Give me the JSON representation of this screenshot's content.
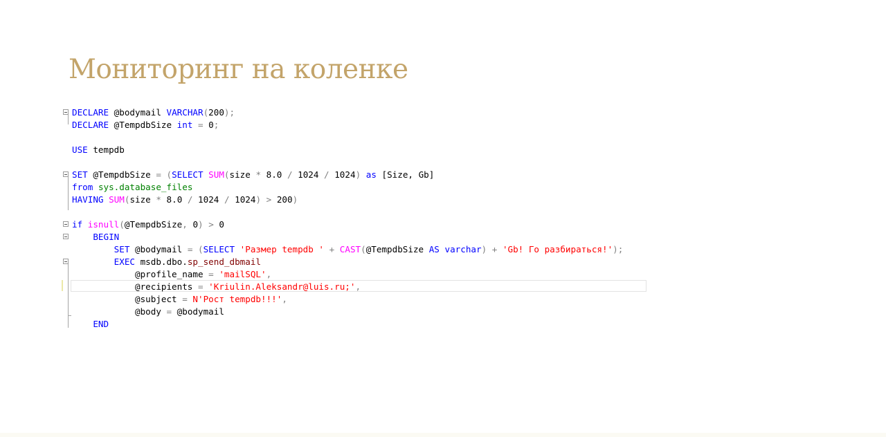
{
  "slide": {
    "title": "Мониторинг на коленке"
  },
  "code_lines": [
    {
      "segments": [
        {
          "t": "DECLARE",
          "c": "kw"
        },
        {
          "t": " @bodymail "
        },
        {
          "t": "VARCHAR",
          "c": "kw"
        },
        {
          "t": "(",
          "c": "op"
        },
        {
          "t": "200"
        },
        {
          "t": ");",
          "c": "op"
        }
      ]
    },
    {
      "segments": [
        {
          "t": "DECLARE",
          "c": "kw"
        },
        {
          "t": " @TempdbSize "
        },
        {
          "t": "int",
          "c": "kw"
        },
        {
          "t": " = ",
          "c": "op"
        },
        {
          "t": "0"
        },
        {
          "t": ";",
          "c": "op"
        }
      ]
    },
    {
      "segments": []
    },
    {
      "segments": [
        {
          "t": "USE",
          "c": "kw"
        },
        {
          "t": " tempdb"
        }
      ]
    },
    {
      "segments": []
    },
    {
      "segments": [
        {
          "t": "SET",
          "c": "kw"
        },
        {
          "t": " @TempdbSize "
        },
        {
          "t": "= (",
          "c": "op"
        },
        {
          "t": "SELECT",
          "c": "kw"
        },
        {
          "t": " "
        },
        {
          "t": "SUM",
          "c": "fn"
        },
        {
          "t": "(",
          "c": "op"
        },
        {
          "t": "size "
        },
        {
          "t": "*",
          "c": "op"
        },
        {
          "t": " 8.0 "
        },
        {
          "t": "/",
          "c": "op"
        },
        {
          "t": " 1024 "
        },
        {
          "t": "/",
          "c": "op"
        },
        {
          "t": " 1024"
        },
        {
          "t": ")",
          "c": "op"
        },
        {
          "t": " "
        },
        {
          "t": "as",
          "c": "kw"
        },
        {
          "t": " [Size, Gb]"
        }
      ]
    },
    {
      "segments": [
        {
          "t": "from",
          "c": "kw"
        },
        {
          "t": " "
        },
        {
          "t": "sys.database_files",
          "c": "sys"
        }
      ]
    },
    {
      "segments": [
        {
          "t": "HAVING",
          "c": "kw"
        },
        {
          "t": " "
        },
        {
          "t": "SUM",
          "c": "fn"
        },
        {
          "t": "(",
          "c": "op"
        },
        {
          "t": "size "
        },
        {
          "t": "*",
          "c": "op"
        },
        {
          "t": " 8.0 "
        },
        {
          "t": "/",
          "c": "op"
        },
        {
          "t": " 1024 "
        },
        {
          "t": "/",
          "c": "op"
        },
        {
          "t": " 1024"
        },
        {
          "t": ")",
          "c": "op"
        },
        {
          "t": " "
        },
        {
          "t": ">",
          "c": "op"
        },
        {
          "t": " 200"
        },
        {
          "t": ")",
          "c": "op"
        }
      ]
    },
    {
      "segments": []
    },
    {
      "segments": [
        {
          "t": "if",
          "c": "kw"
        },
        {
          "t": " "
        },
        {
          "t": "isnull",
          "c": "fn"
        },
        {
          "t": "(",
          "c": "op"
        },
        {
          "t": "@TempdbSize"
        },
        {
          "t": ",",
          "c": "op"
        },
        {
          "t": " 0"
        },
        {
          "t": ")",
          "c": "op"
        },
        {
          "t": " "
        },
        {
          "t": ">",
          "c": "op"
        },
        {
          "t": " 0"
        }
      ]
    },
    {
      "segments": [
        {
          "t": "    "
        },
        {
          "t": "BEGIN",
          "c": "kw"
        }
      ]
    },
    {
      "segments": [
        {
          "t": "        "
        },
        {
          "t": "SET",
          "c": "kw"
        },
        {
          "t": " @bodymail "
        },
        {
          "t": "= (",
          "c": "op"
        },
        {
          "t": "SELECT",
          "c": "kw"
        },
        {
          "t": " "
        },
        {
          "t": "'Размер tempdb '",
          "c": "str"
        },
        {
          "t": " "
        },
        {
          "t": "+",
          "c": "op"
        },
        {
          "t": " "
        },
        {
          "t": "CAST",
          "c": "fn"
        },
        {
          "t": "(",
          "c": "op"
        },
        {
          "t": "@TempdbSize "
        },
        {
          "t": "AS",
          "c": "kw"
        },
        {
          "t": " "
        },
        {
          "t": "varchar",
          "c": "kw"
        },
        {
          "t": ")",
          "c": "op"
        },
        {
          "t": " "
        },
        {
          "t": "+",
          "c": "op"
        },
        {
          "t": " "
        },
        {
          "t": "'Gb! Го разбираться!'",
          "c": "str"
        },
        {
          "t": ");",
          "c": "op"
        }
      ]
    },
    {
      "segments": [
        {
          "t": "        "
        },
        {
          "t": "EXEC",
          "c": "kw"
        },
        {
          "t": " msdb.dbo."
        },
        {
          "t": "sp_send_dbmail",
          "c": "sp"
        }
      ]
    },
    {
      "segments": [
        {
          "t": "            @profile_name "
        },
        {
          "t": "=",
          "c": "op"
        },
        {
          "t": " "
        },
        {
          "t": "'mailSQL'",
          "c": "str"
        },
        {
          "t": ",",
          "c": "op"
        }
      ]
    },
    {
      "segments": [
        {
          "t": "            @recipients "
        },
        {
          "t": "=",
          "c": "op"
        },
        {
          "t": " "
        },
        {
          "t": "'Kriulin.Aleksandr@luis.ru;'",
          "c": "str"
        },
        {
          "t": ",",
          "c": "op"
        }
      ]
    },
    {
      "segments": [
        {
          "t": "            @subject "
        },
        {
          "t": "=",
          "c": "op"
        },
        {
          "t": " "
        },
        {
          "t": "N'Рост tempdb!!!'",
          "c": "str"
        },
        {
          "t": ",",
          "c": "op"
        }
      ]
    },
    {
      "segments": [
        {
          "t": "            @body "
        },
        {
          "t": "=",
          "c": "op"
        },
        {
          "t": " @bodymail"
        }
      ]
    },
    {
      "segments": [
        {
          "t": "    "
        },
        {
          "t": "END",
          "c": "kw"
        }
      ]
    }
  ]
}
